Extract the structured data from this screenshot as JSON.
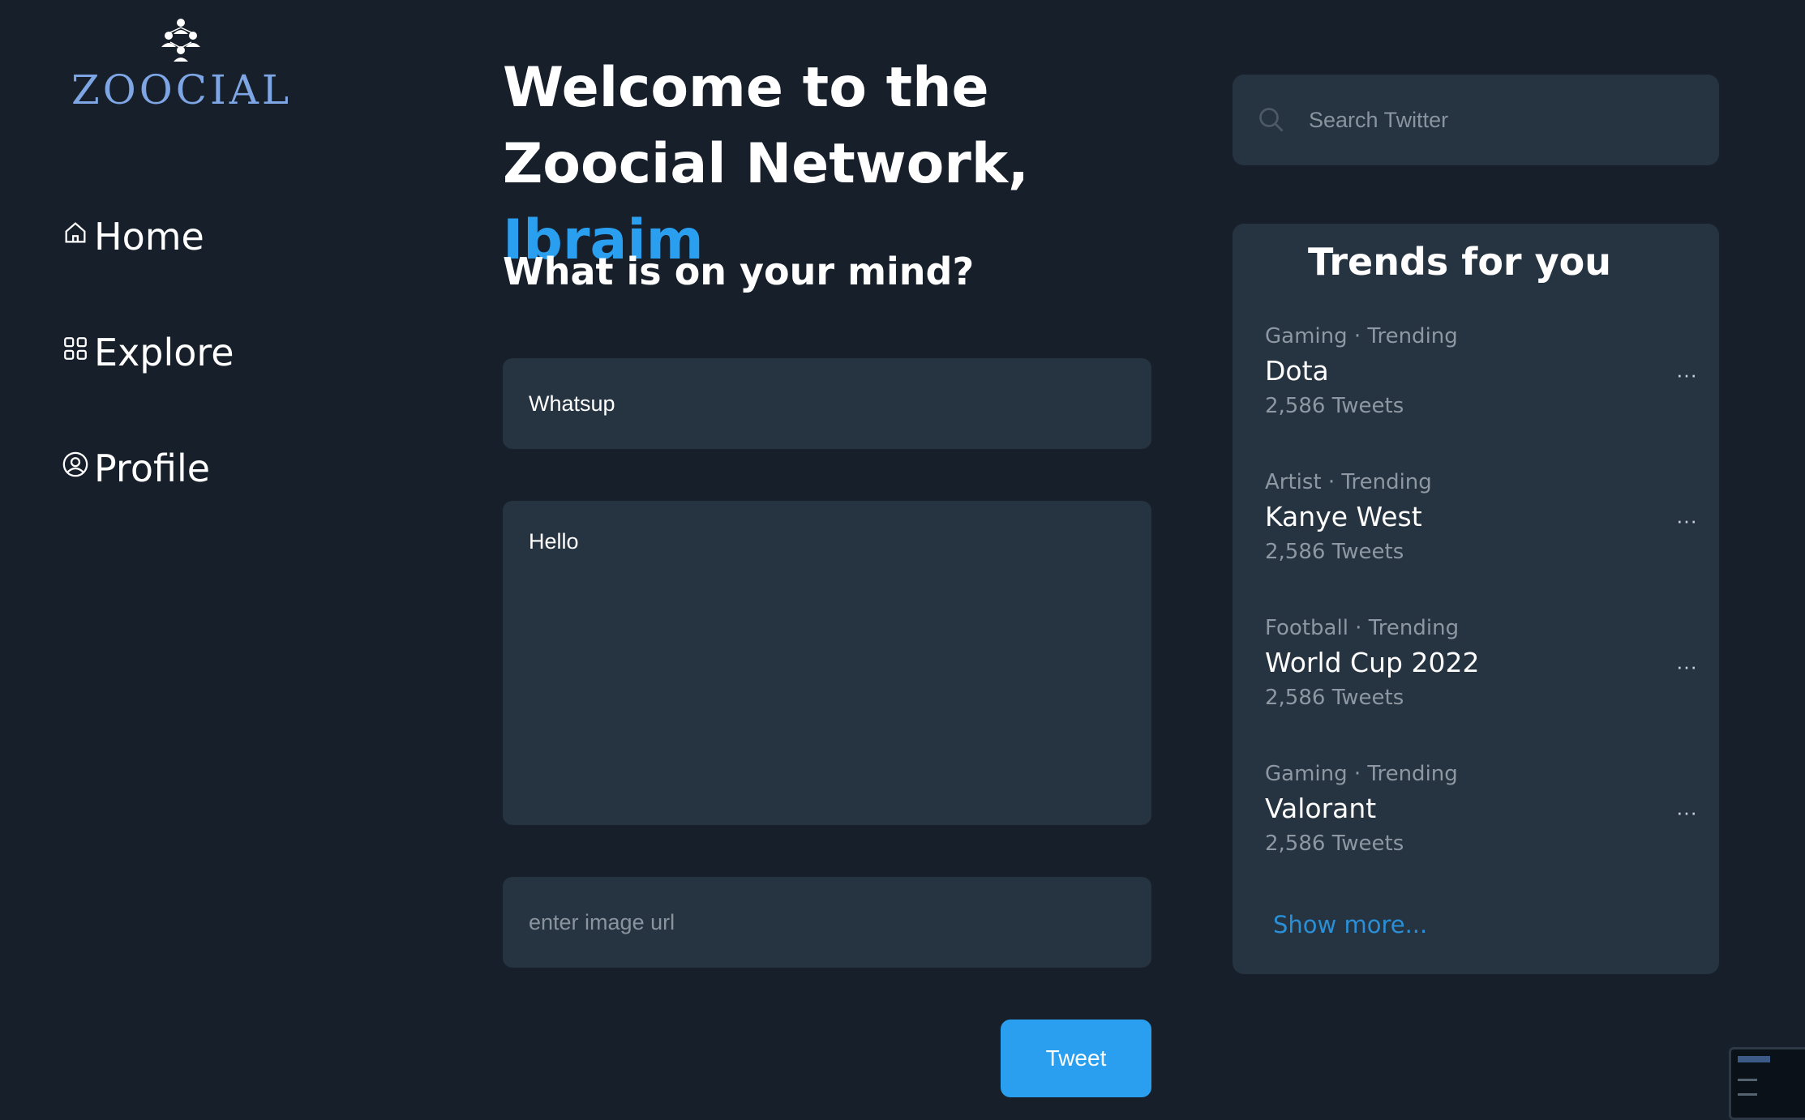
{
  "sidebar": {
    "logo_text": "ZOOCIAL",
    "nav": [
      {
        "label": "Home",
        "icon": "home-icon"
      },
      {
        "label": "Explore",
        "icon": "grid-icon"
      },
      {
        "label": "Profile",
        "icon": "user-circle-icon"
      }
    ]
  },
  "main": {
    "welcome_prefix": "Welcome to the Zoocial Network, ",
    "username": "Ibraim",
    "prompt": "What is on your mind?",
    "title_value": "Whatsup",
    "body_value": "Hello",
    "image_placeholder": "enter image url",
    "tweet_label": "Tweet"
  },
  "search": {
    "placeholder": "Search Twitter",
    "icon": "search-icon"
  },
  "trends": {
    "title": "Trends for you",
    "items": [
      {
        "meta": "Gaming · Trending",
        "name": "Dota",
        "count": "2,586 Tweets"
      },
      {
        "meta": "Artist · Trending",
        "name": "Kanye West",
        "count": "2,586 Tweets"
      },
      {
        "meta": "Football · Trending",
        "name": "World Cup 2022",
        "count": "2,586 Tweets"
      },
      {
        "meta": "Gaming · Trending",
        "name": "Valorant",
        "count": "2,586 Tweets"
      }
    ],
    "more_icon": "more-horizontal-icon",
    "show_more": "Show more..."
  },
  "colors": {
    "background": "#161f2a",
    "panel": "#263340",
    "accent": "#2a9ff0",
    "logo": "#7fa6e4",
    "muted_text": "#8e98a3"
  }
}
